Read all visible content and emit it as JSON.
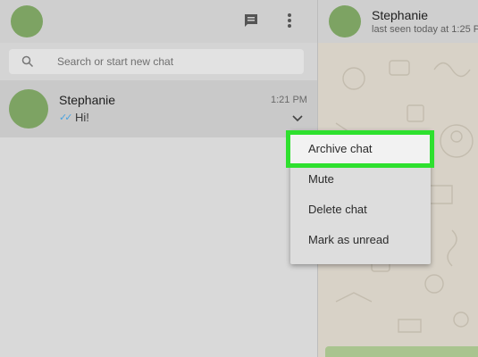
{
  "left_header": {
    "chat_icon": "new-chat-icon",
    "menu_icon": "vertical-dots-menu-icon"
  },
  "search": {
    "placeholder": "Search or start new chat"
  },
  "chat_list": [
    {
      "name": "Stephanie",
      "time": "1:21 PM",
      "ticks": "✓✓",
      "message": "Hi!"
    }
  ],
  "conversation": {
    "name": "Stephanie",
    "status": "last seen today at 1:25 P"
  },
  "context_menu": {
    "items": [
      "Archive chat",
      "Mute",
      "Delete chat",
      "Mark as unread"
    ],
    "highlighted": "Archive chat",
    "highlight_color": "#2ee02e"
  },
  "colors": {
    "avatar": "#7da363",
    "ticks": "#4aa3e0"
  }
}
